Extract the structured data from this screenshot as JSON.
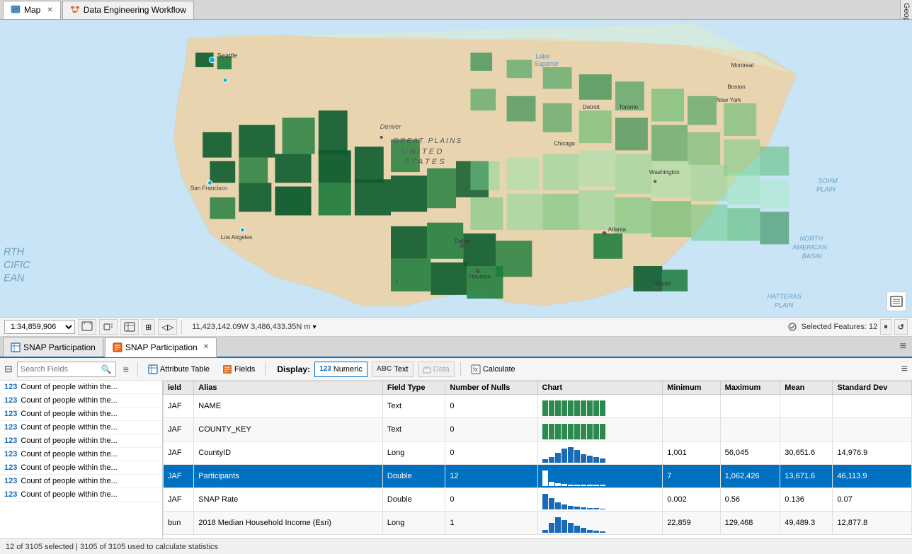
{
  "tabs": [
    {
      "label": "Map",
      "icon": "map",
      "closable": true,
      "active": false
    },
    {
      "label": "Data Engineering Workflow",
      "icon": "workflow",
      "closable": false,
      "active": false
    }
  ],
  "geoprocessing": "Geoprocessing",
  "map": {
    "scale": "1:34,859,906",
    "coordinates": "11,423,142.09W 3,486,433.35N m",
    "selected_features": "Selected Features: 12",
    "coord_dropdown": "▾"
  },
  "panel_tabs": [
    {
      "label": "SNAP Participation",
      "icon": "table",
      "closable": false,
      "active": false
    },
    {
      "label": "SNAP Participation",
      "icon": "fields",
      "closable": true,
      "active": true
    }
  ],
  "toolbar": {
    "search_placeholder": "Search Fields",
    "attribute_table": "Attribute Table",
    "fields": "Fields",
    "display_label": "Display:",
    "numeric_label": "Numeric",
    "text_label": "Text",
    "data_label": "Data",
    "calculate_label": "Calculate"
  },
  "fields_list": [
    "Count of people within the...",
    "Count of people within the...",
    "Count of people within the...",
    "Count of people within the...",
    "Count of people within the...",
    "Count of people within the...",
    "Count of people within the...",
    "Count of people within the...",
    "Count of people within the..."
  ],
  "table_headers": [
    "ield",
    "Alias",
    "Field Type",
    "Number of Nulls",
    "Chart",
    "Minimum",
    "Maximum",
    "Mean",
    "Standard Dev"
  ],
  "table_rows": [
    {
      "field": "JAF",
      "alias": "NAME",
      "type": "Text",
      "nulls": "0",
      "chart": "green_bars",
      "min": "",
      "max": "",
      "mean": "",
      "std": ""
    },
    {
      "field": "JAF",
      "alias": "COUNTY_KEY",
      "type": "Text",
      "nulls": "0",
      "chart": "green_bars",
      "min": "",
      "max": "",
      "mean": "",
      "std": ""
    },
    {
      "field": "JAF",
      "alias": "CountyID",
      "type": "Long",
      "nulls": "0",
      "chart": "blue_bars_varied",
      "min": "1,001",
      "max": "56,045",
      "mean": "30,651.6",
      "std": "14,976.9"
    },
    {
      "field": "JAF",
      "alias": "Participants",
      "type": "Double",
      "nulls": "12",
      "chart": "blue_bars_low",
      "min": "7",
      "max": "1,062,426",
      "mean": "13,671.6",
      "std": "46,113.9",
      "highlighted": true
    },
    {
      "field": "JAF",
      "alias": "SNAP Rate",
      "type": "Double",
      "nulls": "0",
      "chart": "blue_bars_skew",
      "min": "0.002",
      "max": "0.56",
      "mean": "0.136",
      "std": "0.07"
    },
    {
      "field": "bun",
      "alias": "2018 Median Household Income (Esri)",
      "type": "Long",
      "nulls": "1",
      "chart": "blue_bars_med",
      "min": "22,859",
      "max": "129,468",
      "mean": "49,489.3",
      "std": "12,877.8"
    }
  ],
  "status_bar": "12 of 3105 selected | 3105 of 3105 used to calculate statistics",
  "footnote": "Count of people within the  ."
}
